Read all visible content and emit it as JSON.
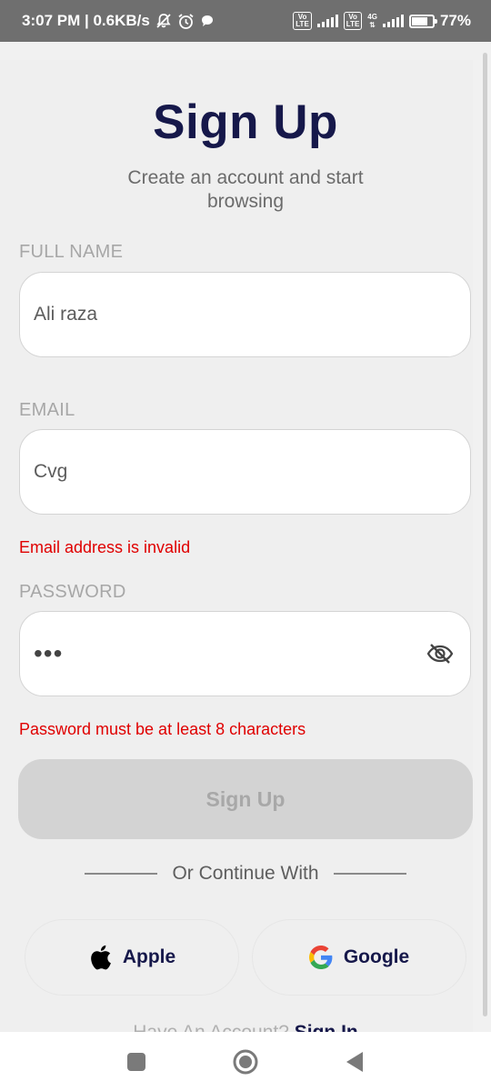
{
  "status_bar": {
    "time_info": "3:07 PM | 0.6KB/s",
    "volte_label": "Vo\nLTE",
    "network_label": "4G",
    "battery_percent": "77%",
    "icons": [
      "mute-bell-icon",
      "alarm-icon",
      "chat-bubble-icon",
      "signal-icon",
      "battery-icon"
    ]
  },
  "header": {
    "title": "Sign Up",
    "subtitle": "Create an account and start browsing"
  },
  "form": {
    "full_name": {
      "label": "FULL NAME",
      "value": "Ali raza"
    },
    "email": {
      "label": "EMAIL",
      "value": "Cvg",
      "error": "Email address is invalid"
    },
    "password": {
      "label": "PASSWORD",
      "value": "•••",
      "error": "Password must be at least 8 characters",
      "toggle_icon": "eye-off-icon"
    },
    "submit_label": "Sign Up"
  },
  "social": {
    "divider_text": "Or Continue With",
    "apple_label": "Apple",
    "google_label": "Google",
    "google_colors": [
      "#4285F4",
      "#EA4335",
      "#FBBC05",
      "#34A853"
    ]
  },
  "footer": {
    "prompt": "Have An Account?",
    "link_label": "Sign In"
  },
  "colors": {
    "primary_text": "#16184a",
    "error": "#e00000",
    "disabled_button": "#d3d3d3"
  }
}
